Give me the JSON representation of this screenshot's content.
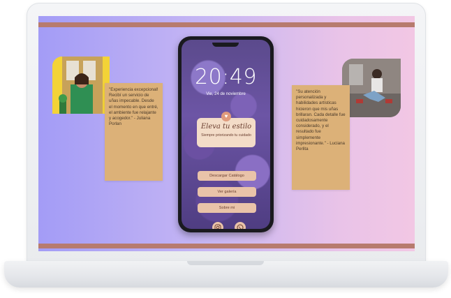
{
  "phone": {
    "time": "20:49",
    "date": "Vie, 24 de noviembre",
    "brand_title": "Eleva tu estilo",
    "brand_subtitle": "Siempre priorizando tu cuidado",
    "buttons": [
      "Descargar Catálogo",
      "Ver galería",
      "Sobre mi"
    ],
    "socials": [
      "instagram-icon",
      "whatsapp-icon"
    ]
  },
  "testimonials": {
    "left": "\"Experiencia excepcional! Recibí un servicio de uñas impecable. Desde el momento en que entré, el ambiente fue relajante y acogedor.\" - Juliana Porlan",
    "right": "\"Su atención personalizada y habilidades artísticas hicieron que mis uñas brillaran. Cada detalle fue cuidadosamente considerado, y el resultado fue simplemente impresionante.\" - Luciana Perlita"
  },
  "colors": {
    "accent_bar": "#b77b6e",
    "note": "#dcb178",
    "button": "#e9c3a9"
  }
}
